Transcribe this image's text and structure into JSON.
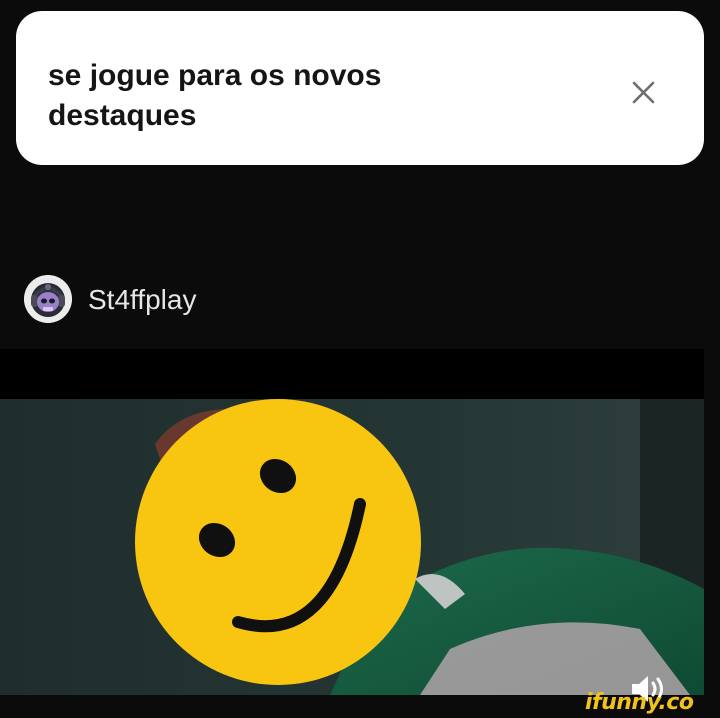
{
  "banner": {
    "title": "se jogue para os novos\ndestaques",
    "close_icon": "close-icon"
  },
  "post": {
    "username": "St4ffplay",
    "avatar_icon": "avatar-skull-headphones"
  },
  "video": {
    "overlay_icon": "smiley-face-icon",
    "sound_icon": "speaker-icon"
  },
  "watermark": {
    "text": "ifunny.co"
  },
  "colors": {
    "background": "#0b0b0b",
    "banner": "#ffffff",
    "smiley": "#f8c511",
    "watermark": "#f2c21a",
    "username": "#e6e6e6"
  }
}
